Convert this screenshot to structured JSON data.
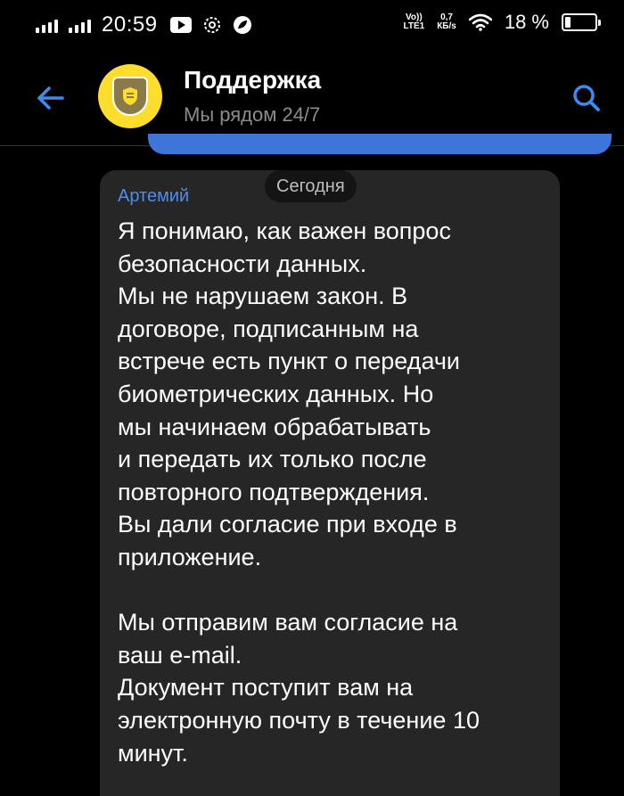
{
  "status_bar": {
    "time": "20:59",
    "volte_line1": "Vo))",
    "volte_line2": "LTE1",
    "net_speed_value": "0,7",
    "net_speed_unit": "КБ/s",
    "battery_percent": "18 %",
    "battery_level": 0.18
  },
  "header": {
    "title": "Поддержка",
    "subtitle": "Мы рядом 24/7",
    "accent_color": "#3d8bef",
    "avatar_color": "#ffdd2d"
  },
  "chat": {
    "date_chip": "Сегодня",
    "message": {
      "sender": "Артемий",
      "text": "Я понимаю, как важен вопрос\nбезопасности данных.\nМы не нарушаем закон. В\nдоговоре, подписанным на\nвстрече есть пункт о передачи\nбиометрических данных. Но\nмы начинаем обрабатывать\nи передать их только после\nповторного подтверждения.\nВы дали согласие при входе в\nприложение.\n\nМы отправим вам согласие на\nваш e-mail.\nДокумент поступит вам на\nэлектронную почту в течение 10\nминут."
    }
  },
  "icons": {
    "back": "arrow-left-icon",
    "search": "search-icon",
    "wifi": "wifi-icon",
    "youtube": "youtube-icon",
    "battery": "battery-icon"
  }
}
